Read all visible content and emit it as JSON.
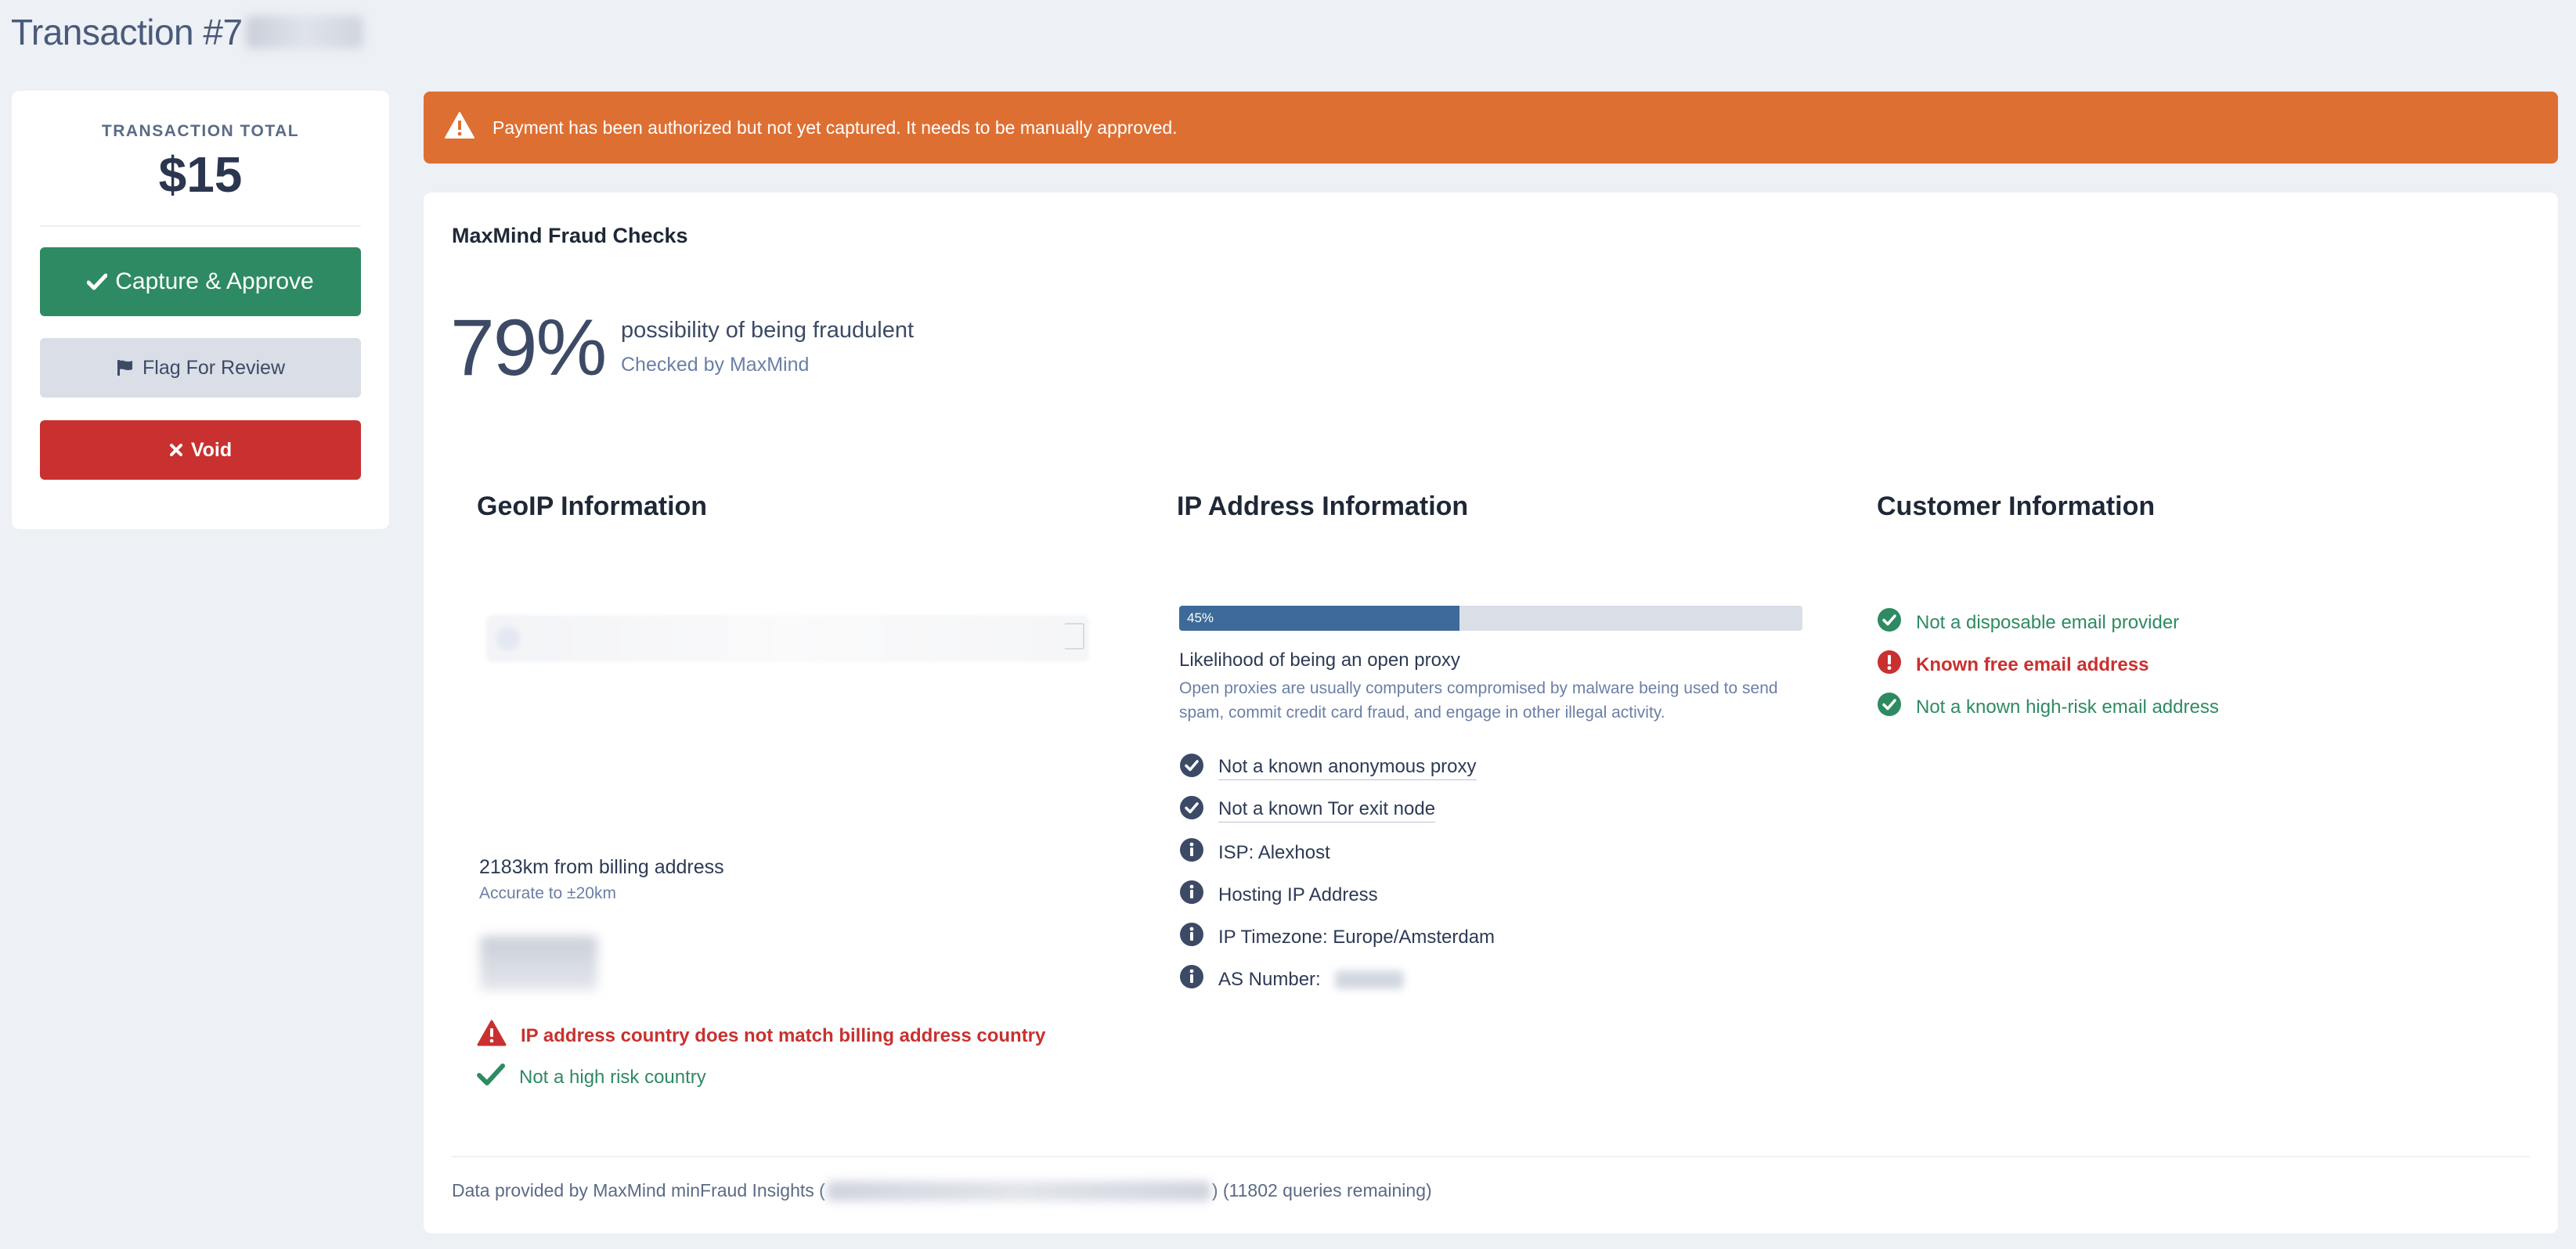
{
  "page": {
    "title": "Transaction #7"
  },
  "sidebar": {
    "total_label": "TRANSACTION TOTAL",
    "total_amount": "$15",
    "approve_label": "Capture & Approve",
    "flag_label": "Flag For Review",
    "void_label": "Void"
  },
  "alert": {
    "message": "Payment has been authorized but not yet captured. It needs to be manually approved."
  },
  "fraud": {
    "card_title": "MaxMind Fraud Checks",
    "percent": "79%",
    "description": "possibility of being fraudulent",
    "checked_by": "Checked by MaxMind"
  },
  "geoip": {
    "title": "GeoIP Information",
    "distance": "2183km from billing address",
    "accuracy": "Accurate to ±20km",
    "checks": [
      {
        "label": "IP address country does not match billing address country",
        "status": "warning"
      },
      {
        "label": "Not a high risk country",
        "status": "ok"
      }
    ]
  },
  "ip_info": {
    "title": "IP Address Information",
    "proxy_score": 45,
    "proxy_score_label": "45%",
    "proxy_title": "Likelihood of being an open proxy",
    "proxy_description": "Open proxies are usually computers compromised by malware being used to send spam, commit credit card fraud, and engage in other illegal activity.",
    "items": [
      {
        "label": "Not a known anonymous proxy",
        "icon": "check-circle-icon"
      },
      {
        "label": "Not a known Tor exit node",
        "icon": "check-circle-icon"
      },
      {
        "label": "ISP: Alexhost",
        "icon": "info-icon"
      },
      {
        "label": "Hosting IP Address",
        "icon": "info-icon"
      },
      {
        "label": "IP Timezone: Europe/Amsterdam",
        "icon": "info-icon"
      },
      {
        "label": "AS Number:",
        "icon": "info-icon"
      }
    ]
  },
  "customer": {
    "title": "Customer Information",
    "items": [
      {
        "label": "Not a disposable email provider",
        "status": "ok"
      },
      {
        "label": "Known free email address",
        "status": "error"
      },
      {
        "label": "Not a known high-risk email address",
        "status": "ok"
      }
    ]
  },
  "footer": {
    "prefix": "Data provided by MaxMind minFraud Insights (",
    "suffix": ") (11802 queries remaining)"
  },
  "colors": {
    "approve": "#2e8a62",
    "void": "#c8312f",
    "alert": "#de6f32",
    "progress": "#3d6a98"
  }
}
